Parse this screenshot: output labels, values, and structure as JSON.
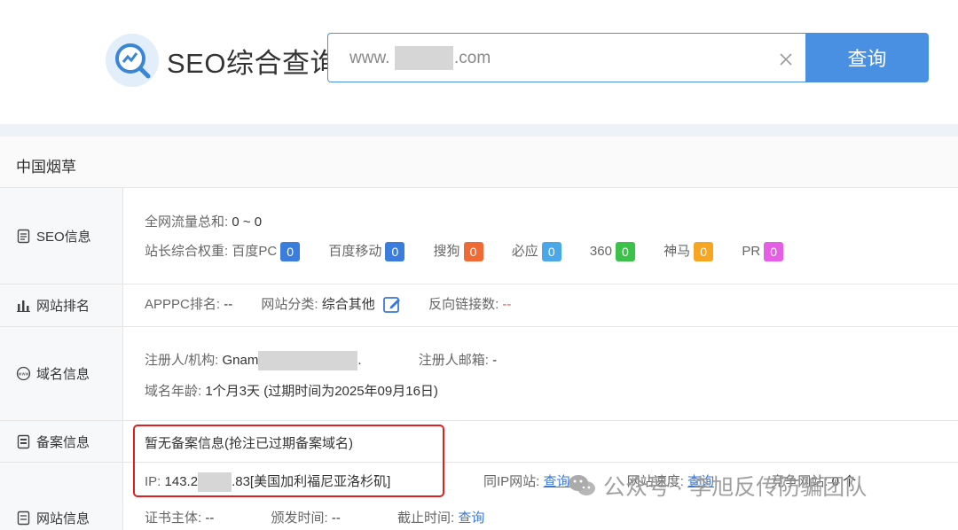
{
  "header": {
    "title": "SEO综合查询",
    "search_prefix": "www.",
    "search_suffix": ".com",
    "search_button": "查询"
  },
  "company": "中国烟草",
  "seo": {
    "label": "SEO信息",
    "traffic_label": "全网流量总和:",
    "traffic_value": "0 ~ 0",
    "weight_label": "站长综合权重:",
    "weights": [
      {
        "name": "百度PC",
        "value": "0",
        "color": "#3b7ddd"
      },
      {
        "name": "百度移动",
        "value": "0",
        "color": "#3b7ddd"
      },
      {
        "name": "搜狗",
        "value": "0",
        "color": "#f06a35"
      },
      {
        "name": "必应",
        "value": "0",
        "color": "#4aa8e8"
      },
      {
        "name": "360",
        "value": "0",
        "color": "#3cc24a"
      },
      {
        "name": "神马",
        "value": "0",
        "color": "#f5a623"
      },
      {
        "name": "PR",
        "value": "0",
        "color": "#e65ee6"
      }
    ]
  },
  "rank": {
    "label": "网站排名",
    "apppc_label": "APPPC排名:",
    "apppc_value": "--",
    "category_label": "网站分类:",
    "category_value": "综合其他",
    "backlinks_label": "反向链接数:",
    "backlinks_value": "--"
  },
  "domain": {
    "label": "域名信息",
    "registrant_label": "注册人/机构:",
    "registrant_value": "Gnam",
    "registrant_tail": ".",
    "email_label": "注册人邮箱:",
    "email_value": "-",
    "age_label": "域名年龄:",
    "age_value": "1个月3天 (过期时间为2025年09月16日)"
  },
  "icp": {
    "label": "备案信息",
    "value": "暂无备案信息(抢注已过期备案域名)"
  },
  "site": {
    "label": "网站信息",
    "ip_label": "IP:",
    "ip_start": "143.2",
    "ip_end": ".83[美国加利福尼亚洛杉矶]",
    "same_ip_label": "同IP网站:",
    "same_ip_value": "查询",
    "speed_label": "网站速度:",
    "speed_value": "查询",
    "competitor_label": "竞争网站:",
    "competitor_value": "0 个",
    "cert_label": "证书主体:",
    "cert_value": "--",
    "issue_label": "颁发时间:",
    "issue_value": "--",
    "expire_label": "截止时间:",
    "expire_value": "查询"
  },
  "watermark": "公众号 · 李旭反传防骗团队"
}
